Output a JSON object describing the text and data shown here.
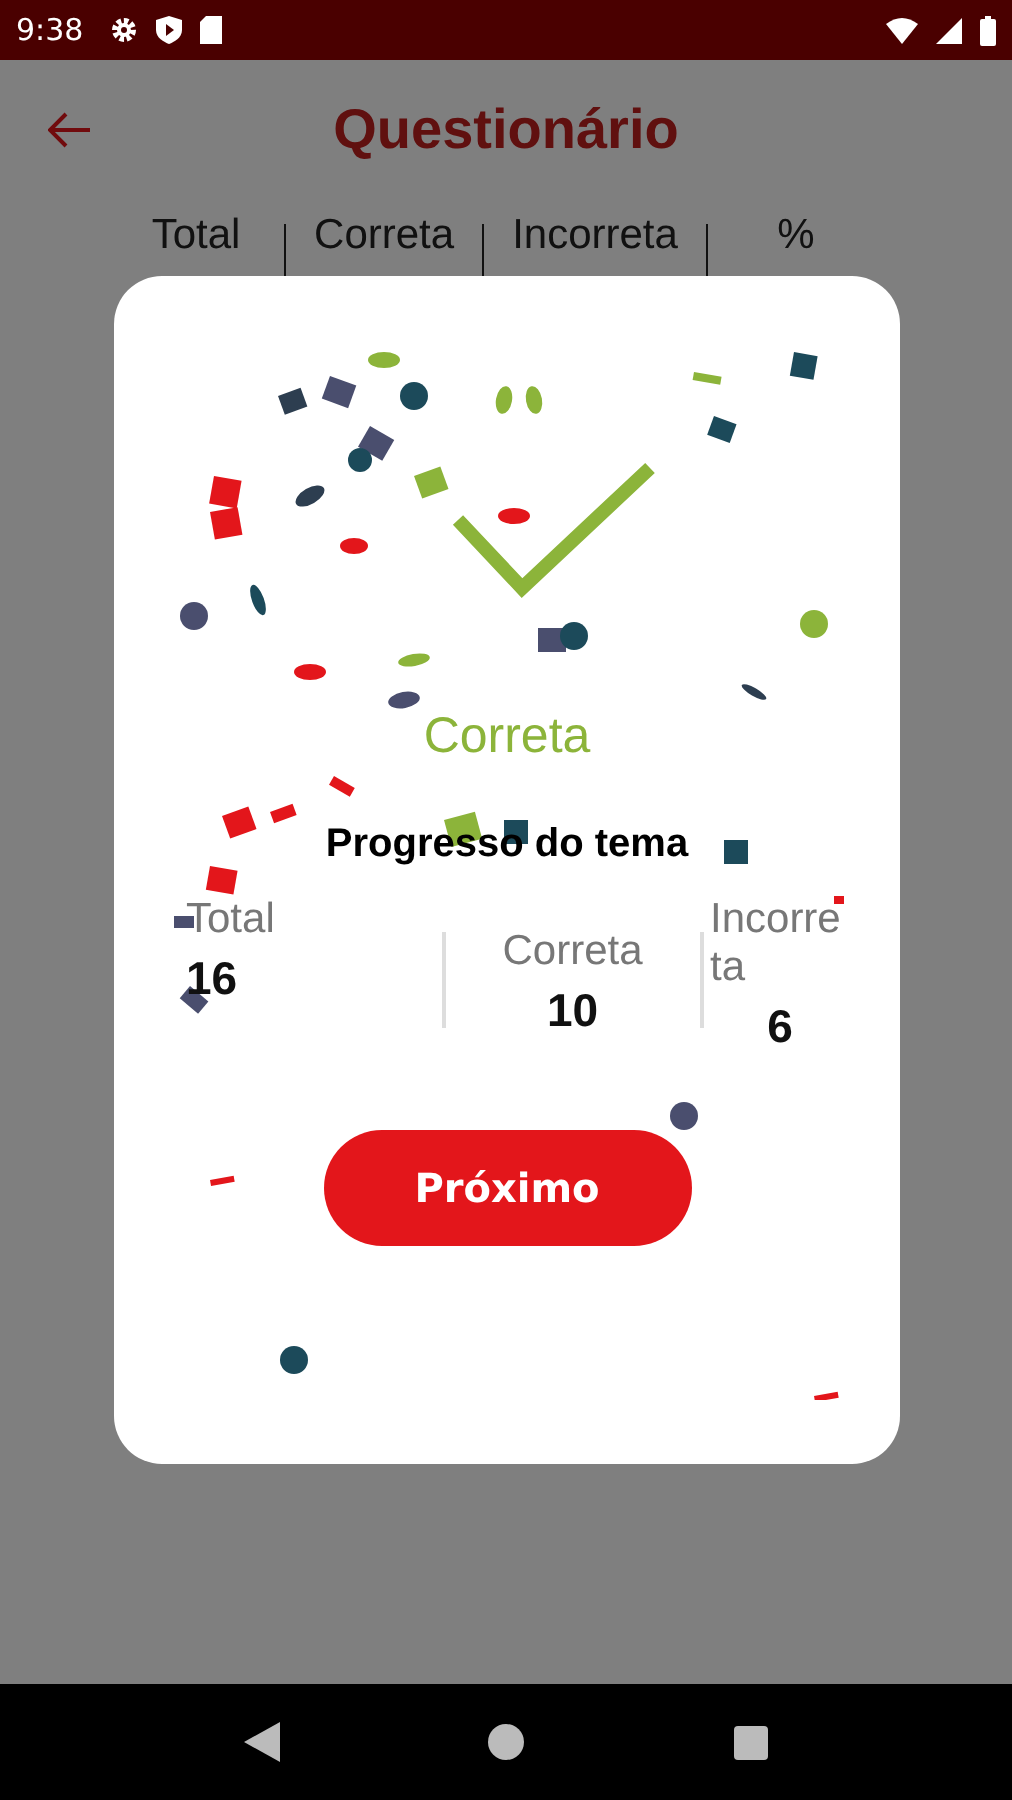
{
  "status_bar": {
    "time": "9:38"
  },
  "app_bar": {
    "title": "Questionário"
  },
  "header_columns": [
    "Total",
    "Correta",
    "Incorreta",
    "%"
  ],
  "dialog": {
    "result": "Correta",
    "progress_title": "Progresso do tema",
    "stats": [
      {
        "label": "Total",
        "value": "16"
      },
      {
        "label": "Correta",
        "value": "10"
      },
      {
        "label": "Incorre ta",
        "value": "6"
      }
    ],
    "button": "Próximo"
  }
}
